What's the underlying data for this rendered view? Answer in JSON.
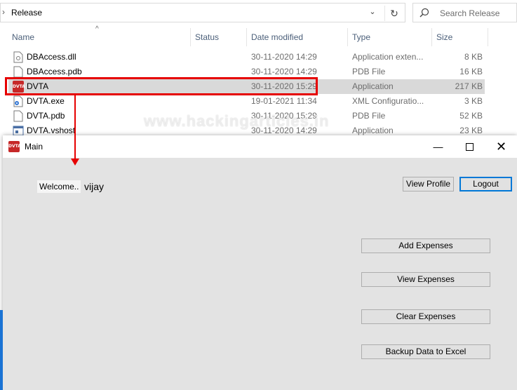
{
  "explorer": {
    "address": "Release",
    "search_placeholder": "Search Release",
    "columns": {
      "name": "Name",
      "status": "Status",
      "date": "Date modified",
      "type": "Type",
      "size": "Size"
    },
    "files": [
      {
        "name": "DBAccess.dll",
        "date": "30-11-2020 14:29",
        "type": "Application exten...",
        "size": "8 KB",
        "icon": "dll-file-icon"
      },
      {
        "name": "DBAccess.pdb",
        "date": "30-11-2020 14:29",
        "type": "PDB File",
        "size": "16 KB",
        "icon": "pdb-file-icon"
      },
      {
        "name": "DVTA",
        "date": "30-11-2020 15:29",
        "type": "Application",
        "size": "217 KB",
        "icon": "dvta-app-icon"
      },
      {
        "name": "DVTA.exe",
        "date": "19-01-2021 11:34",
        "type": "XML Configuratio...",
        "size": "3 KB",
        "icon": "config-file-icon"
      },
      {
        "name": "DVTA.pdb",
        "date": "30-11-2020 15:29",
        "type": "PDB File",
        "size": "52 KB",
        "icon": "pdb-file-icon"
      },
      {
        "name": "DVTA.vshost",
        "date": "30-11-2020 14:29",
        "type": "Application",
        "size": "23 KB",
        "icon": "vshost-app-icon"
      }
    ]
  },
  "watermark": "www.hackingarticles.in",
  "main_window": {
    "title": "Main",
    "app_icon_text": "DVTA",
    "welcome_label": "Welcome..",
    "username": "vijay",
    "buttons": {
      "view_profile": "View Profile",
      "logout": "Logout",
      "add_expenses": "Add  Expenses",
      "view_expenses": "View Expenses",
      "clear_expenses": "Clear Expenses",
      "backup": "Backup Data to Excel"
    }
  },
  "colors": {
    "highlight": "#e60000",
    "focus": "#0078d7",
    "dvta_icon": "#c62828"
  }
}
